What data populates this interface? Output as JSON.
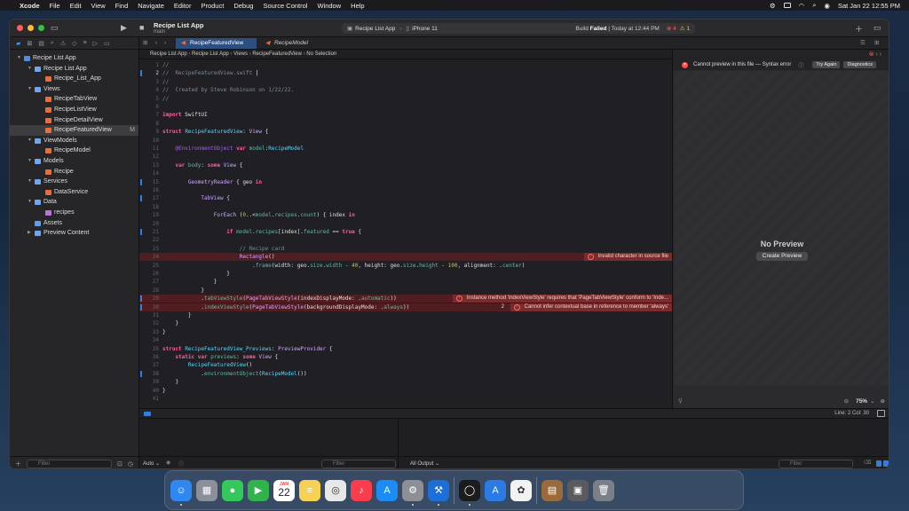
{
  "menubar": {
    "app": "Xcode",
    "items": [
      "File",
      "Edit",
      "View",
      "Find",
      "Navigate",
      "Editor",
      "Product",
      "Debug",
      "Source Control",
      "Window",
      "Help"
    ],
    "datetime": "Sat Jan 22  12:55 PM"
  },
  "toolbar": {
    "project_title": "Recipe List App",
    "branch": "main",
    "scheme": "Recipe List App",
    "device": "iPhone 11",
    "status_prefix": "Build",
    "status_bold": "Failed",
    "status_suffix": "| Today at 12:44 PM",
    "error_count": "4",
    "warning_count": "1"
  },
  "sidebar": {
    "filter_placeholder": "Filter",
    "items": [
      {
        "label": "Recipe List App",
        "depth": 0,
        "icon": "project-icon",
        "disclosure": "open"
      },
      {
        "label": "Recipe List App",
        "depth": 1,
        "icon": "folder-icon",
        "disclosure": "open"
      },
      {
        "label": "Recipe_List_App",
        "depth": 2,
        "icon": "swift-file-icon",
        "disclosure": ""
      },
      {
        "label": "Views",
        "depth": 1,
        "icon": "folder-icon",
        "disclosure": "open"
      },
      {
        "label": "RecipeTabView",
        "depth": 2,
        "icon": "swift-file-icon",
        "disclosure": ""
      },
      {
        "label": "RecipeListView",
        "depth": 2,
        "icon": "swift-file-icon",
        "disclosure": ""
      },
      {
        "label": "RecipeDetailView",
        "depth": 2,
        "icon": "swift-file-icon",
        "disclosure": ""
      },
      {
        "label": "RecipeFeaturedView",
        "depth": 2,
        "icon": "swift-file-icon",
        "disclosure": "",
        "selected": true,
        "badge": "M"
      },
      {
        "label": "ViewModels",
        "depth": 1,
        "icon": "folder-icon",
        "disclosure": "open"
      },
      {
        "label": "RecipeModel",
        "depth": 2,
        "icon": "swift-file-icon",
        "disclosure": ""
      },
      {
        "label": "Models",
        "depth": 1,
        "icon": "folder-icon",
        "disclosure": "open"
      },
      {
        "label": "Recipe",
        "depth": 2,
        "icon": "swift-file-icon",
        "disclosure": ""
      },
      {
        "label": "Services",
        "depth": 1,
        "icon": "folder-icon",
        "disclosure": "open"
      },
      {
        "label": "DataService",
        "depth": 2,
        "icon": "swift-file-icon",
        "disclosure": ""
      },
      {
        "label": "Data",
        "depth": 1,
        "icon": "folder-icon",
        "disclosure": "open"
      },
      {
        "label": "recipes",
        "depth": 2,
        "icon": "json-file-icon",
        "disclosure": ""
      },
      {
        "label": "Assets",
        "depth": 1,
        "icon": "assets-icon",
        "disclosure": ""
      },
      {
        "label": "Preview Content",
        "depth": 1,
        "icon": "folder-icon",
        "disclosure": "closed"
      }
    ]
  },
  "tabs": [
    {
      "label": "RecipeFeaturedView",
      "active": true
    },
    {
      "label": "RecipeModel",
      "active": false
    }
  ],
  "jumpbar": [
    "Recipe List App",
    "Recipe List App",
    "Views",
    "RecipeFeaturedView",
    "No Selection"
  ],
  "code": [
    {
      "n": "1",
      "segs": [
        [
          "cm",
          "//"
        ]
      ]
    },
    {
      "n": "2",
      "segs": [
        [
          "cm",
          "//  RecipeFeaturedView.swift"
        ]
      ],
      "current": true,
      "mark": true
    },
    {
      "n": "3",
      "segs": [
        [
          "cm",
          "//"
        ]
      ]
    },
    {
      "n": "4",
      "segs": [
        [
          "cm",
          "//  Created by Steve Robinson on 1/22/22."
        ]
      ]
    },
    {
      "n": "5",
      "segs": [
        [
          "cm",
          "//"
        ]
      ]
    },
    {
      "n": "6",
      "segs": []
    },
    {
      "n": "7",
      "segs": [
        [
          "k",
          "import"
        ],
        [
          "",
          " SwiftUI"
        ]
      ]
    },
    {
      "n": "8",
      "segs": []
    },
    {
      "n": "9",
      "segs": [
        [
          "k",
          "struct"
        ],
        [
          "",
          " "
        ],
        [
          "t",
          "RecipeFeaturedView"
        ],
        [
          "",
          ": "
        ],
        [
          "tp",
          "View"
        ],
        [
          "",
          " {"
        ]
      ]
    },
    {
      "n": "10",
      "segs": []
    },
    {
      "n": "11",
      "segs": [
        [
          "",
          "    "
        ],
        [
          "at",
          "@EnvironmentObject"
        ],
        [
          "",
          " "
        ],
        [
          "k",
          "var"
        ],
        [
          "",
          " "
        ],
        [
          "fn",
          "model"
        ],
        [
          "",
          ":"
        ],
        [
          "t",
          "RecipeModel"
        ]
      ]
    },
    {
      "n": "12",
      "segs": []
    },
    {
      "n": "13",
      "segs": [
        [
          "",
          "    "
        ],
        [
          "k",
          "var"
        ],
        [
          "",
          " "
        ],
        [
          "fn",
          "body"
        ],
        [
          "",
          ": "
        ],
        [
          "k",
          "some"
        ],
        [
          "",
          " "
        ],
        [
          "tp",
          "View"
        ],
        [
          "",
          " {"
        ]
      ]
    },
    {
      "n": "14",
      "segs": []
    },
    {
      "n": "15",
      "segs": [
        [
          "",
          "        "
        ],
        [
          "tp",
          "GeometryReader"
        ],
        [
          "",
          " { geo "
        ],
        [
          "k",
          "in"
        ]
      ],
      "mark": true
    },
    {
      "n": "16",
      "segs": []
    },
    {
      "n": "17",
      "segs": [
        [
          "",
          "            "
        ],
        [
          "tp",
          "TabView"
        ],
        [
          "",
          " {"
        ]
      ],
      "mark": true
    },
    {
      "n": "18",
      "segs": []
    },
    {
      "n": "19",
      "segs": [
        [
          "",
          "                "
        ],
        [
          "tp",
          "ForEach"
        ],
        [
          "",
          " ("
        ],
        [
          "n",
          "0"
        ],
        [
          "",
          "..<"
        ],
        [
          "fn",
          "model"
        ],
        [
          "",
          "."
        ],
        [
          "fn",
          "recipes"
        ],
        [
          "",
          "."
        ],
        [
          "fn",
          "count"
        ],
        [
          "",
          ") { index "
        ],
        [
          "k",
          "in"
        ]
      ]
    },
    {
      "n": "20",
      "segs": []
    },
    {
      "n": "21",
      "segs": [
        [
          "",
          "                    "
        ],
        [
          "k",
          "if"
        ],
        [
          "",
          " "
        ],
        [
          "fn",
          "model"
        ],
        [
          "",
          "."
        ],
        [
          "fn",
          "recipes"
        ],
        [
          "",
          "[index]."
        ],
        [
          "fn",
          "featured"
        ],
        [
          "",
          " == "
        ],
        [
          "k",
          "true"
        ],
        [
          "",
          " {"
        ]
      ],
      "mark": true
    },
    {
      "n": "22",
      "segs": []
    },
    {
      "n": "23",
      "segs": [
        [
          "",
          "                        "
        ],
        [
          "cm",
          "// Recipe card"
        ]
      ]
    },
    {
      "n": "24",
      "segs": [
        [
          "",
          "                        "
        ],
        [
          "tp",
          "Rectangle"
        ],
        [
          "",
          "()"
        ]
      ],
      "error": "Invalid character in source file"
    },
    {
      "n": "25",
      "segs": [
        [
          "",
          "                            ."
        ],
        [
          "fn",
          "frame"
        ],
        [
          "",
          "(width: geo."
        ],
        [
          "fn",
          "size"
        ],
        [
          "",
          "."
        ],
        [
          "fn",
          "width"
        ],
        [
          "",
          " - "
        ],
        [
          "n",
          "40"
        ],
        [
          "",
          ", height: geo."
        ],
        [
          "fn",
          "size"
        ],
        [
          "",
          "."
        ],
        [
          "fn",
          "height"
        ],
        [
          "",
          " - "
        ],
        [
          "n",
          "100"
        ],
        [
          "",
          ", alignment: ."
        ],
        [
          "fn",
          "center"
        ],
        [
          "",
          ")"
        ]
      ]
    },
    {
      "n": "26",
      "segs": [
        [
          "",
          "                    }"
        ]
      ]
    },
    {
      "n": "27",
      "segs": [
        [
          "",
          "                }"
        ]
      ]
    },
    {
      "n": "28",
      "segs": [
        [
          "",
          "            }"
        ]
      ]
    },
    {
      "n": "29",
      "segs": [
        [
          "",
          "            ."
        ],
        [
          "fn",
          "tabViewStyle"
        ],
        [
          "",
          "("
        ],
        [
          "tp",
          "PageTabViewStyle"
        ],
        [
          "",
          "(indexDisplayMode: ."
        ],
        [
          "fn",
          "automatic"
        ],
        [
          "",
          "))"
        ]
      ],
      "error": "Instance method 'indexViewStyle' requires that 'PageTabViewStyle' conform to 'Inde...",
      "mark": true
    },
    {
      "n": "30",
      "segs": [
        [
          "",
          "            ."
        ],
        [
          "fn",
          "indexViewStyle"
        ],
        [
          "",
          "("
        ],
        [
          "tp",
          "PageTabViewStyle"
        ],
        [
          "",
          "(backgroundDisplayMode: ."
        ],
        [
          "fn",
          "always"
        ],
        [
          "",
          "))"
        ]
      ],
      "error": "Cannot infer contextual base in reference to member 'always'",
      "error_count": "2",
      "mark": true
    },
    {
      "n": "31",
      "segs": [
        [
          "",
          "        }"
        ]
      ]
    },
    {
      "n": "32",
      "segs": [
        [
          "",
          "    }"
        ]
      ]
    },
    {
      "n": "33",
      "segs": [
        [
          "",
          "}"
        ]
      ]
    },
    {
      "n": "34",
      "segs": []
    },
    {
      "n": "35",
      "segs": [
        [
          "k",
          "struct"
        ],
        [
          "",
          " "
        ],
        [
          "t",
          "RecipeFeaturedView_Previews"
        ],
        [
          "",
          ": "
        ],
        [
          "tp",
          "PreviewProvider"
        ],
        [
          "",
          " {"
        ]
      ]
    },
    {
      "n": "36",
      "segs": [
        [
          "",
          "    "
        ],
        [
          "k",
          "static"
        ],
        [
          "",
          " "
        ],
        [
          "k",
          "var"
        ],
        [
          "",
          " "
        ],
        [
          "fn",
          "previews"
        ],
        [
          "",
          ": "
        ],
        [
          "k",
          "some"
        ],
        [
          "",
          " "
        ],
        [
          "tp",
          "View"
        ],
        [
          "",
          " {"
        ]
      ]
    },
    {
      "n": "37",
      "segs": [
        [
          "",
          "        "
        ],
        [
          "t",
          "RecipeFeaturedView"
        ],
        [
          "",
          "()"
        ]
      ]
    },
    {
      "n": "38",
      "segs": [
        [
          "",
          "            ."
        ],
        [
          "fn",
          "environmentObject"
        ],
        [
          "",
          "("
        ],
        [
          "t",
          "RecipeModel"
        ],
        [
          "",
          "())"
        ]
      ],
      "mark": true
    },
    {
      "n": "39",
      "segs": [
        [
          "",
          "    }"
        ]
      ]
    },
    {
      "n": "40",
      "segs": [
        [
          "",
          "}"
        ]
      ]
    },
    {
      "n": "41",
      "segs": []
    }
  ],
  "canvas": {
    "error_text": "Cannot preview in this file — Syntax error",
    "try_again": "Try Again",
    "diagnostics": "Diagnostics",
    "no_preview": "No Preview",
    "create_preview": "Create Preview",
    "zoom": "75%"
  },
  "statusbar": {
    "position": "Line: 2  Col: 30"
  },
  "debug": {
    "auto": "Auto",
    "filter_placeholder": "Filter",
    "output": "All Output",
    "filter2_placeholder": "Filter"
  },
  "dock": {
    "calendar_month": "JAN",
    "calendar_day": "22",
    "apps": [
      {
        "name": "finder-icon",
        "color": "#2f88f0",
        "glyph": "☺"
      },
      {
        "name": "launchpad-icon",
        "color": "#8a8f99",
        "glyph": "▦"
      },
      {
        "name": "messages-icon",
        "color": "#34c759",
        "glyph": "●"
      },
      {
        "name": "facetime-icon",
        "color": "#2fb34a",
        "glyph": "▶"
      },
      {
        "name": "calendar-icon",
        "color": "#ffffff",
        "glyph": ""
      },
      {
        "name": "notes-icon",
        "color": "#f7d154",
        "glyph": "≡"
      },
      {
        "name": "chrome-icon",
        "color": "#e8e8e8",
        "glyph": "◎"
      },
      {
        "name": "music-icon",
        "color": "#fa3c4c",
        "glyph": "♪"
      },
      {
        "name": "app-store-icon",
        "color": "#1b8cf5",
        "glyph": "A"
      },
      {
        "name": "system-preferences-icon",
        "color": "#8d8f94",
        "glyph": "⚙"
      },
      {
        "name": "xcode-icon",
        "color": "#1c6fd6",
        "glyph": "⚒"
      },
      {
        "name": "circle-app-icon",
        "color": "#1c1c1e",
        "glyph": "◯"
      },
      {
        "name": "instruments-icon",
        "color": "#2a7be4",
        "glyph": "A"
      },
      {
        "name": "photos-icon",
        "color": "#f2f2f2",
        "glyph": "✿"
      },
      {
        "name": "downloads-stack-icon",
        "color": "#9a6a3a",
        "glyph": "▤"
      },
      {
        "name": "screenshots-stack-icon",
        "color": "#5a5a5f",
        "glyph": "▣"
      },
      {
        "name": "trash-icon",
        "color": "#7a7f88",
        "glyph": "🗑"
      }
    ]
  }
}
